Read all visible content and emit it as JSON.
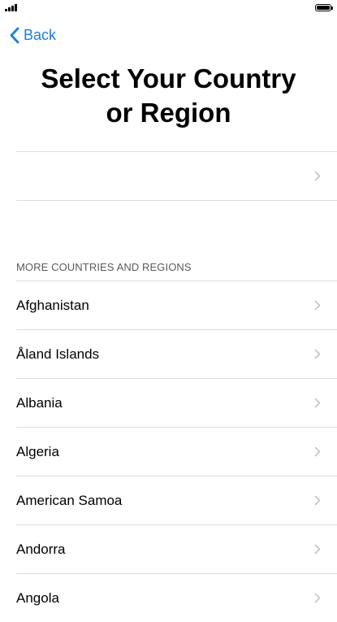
{
  "status_bar": {
    "signal_icon": "cellular-signal-icon",
    "battery_icon": "battery-icon"
  },
  "nav": {
    "back_label": "Back",
    "back_icon": "chevron-left-icon",
    "accent_color": "#1a7ee6"
  },
  "page": {
    "title_line1": "Select Your Country",
    "title_line2": "or Region"
  },
  "suggested_country": {
    "label": ""
  },
  "section": {
    "header": "MORE COUNTRIES AND REGIONS"
  },
  "countries": [
    {
      "name": "Afghanistan"
    },
    {
      "name": "Åland Islands"
    },
    {
      "name": "Albania"
    },
    {
      "name": "Algeria"
    },
    {
      "name": "American Samoa"
    },
    {
      "name": "Andorra"
    },
    {
      "name": "Angola"
    }
  ]
}
